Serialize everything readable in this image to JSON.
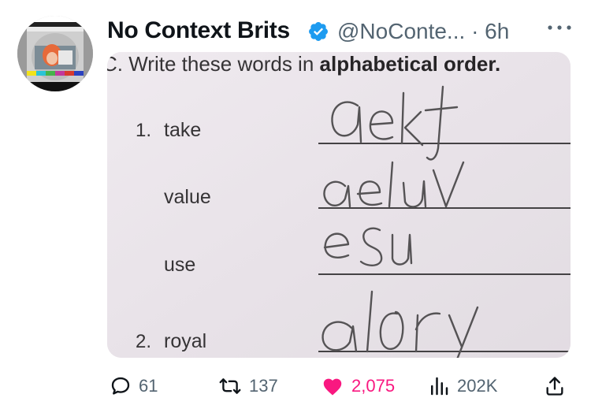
{
  "post": {
    "author": {
      "display_name": "No Context Brits",
      "handle": "@NoConte...",
      "separator": "·",
      "time": "6h"
    },
    "media": {
      "header_prefix": "C. Write these words in ",
      "header_bold": "alphabetical order.",
      "rows": [
        {
          "number": "1.",
          "word": "take",
          "answer": "aekt"
        },
        {
          "number": "",
          "word": "value",
          "answer": "aeluv"
        },
        {
          "number": "",
          "word": "use",
          "answer": "esu"
        },
        {
          "number": "2.",
          "word": "royal",
          "answer": "alory"
        }
      ]
    },
    "metrics": {
      "replies": "61",
      "reposts": "137",
      "likes": "2,075",
      "views": "202K"
    }
  },
  "colors": {
    "text": "#0f1419",
    "secondary": "#536471",
    "verified": "#1d9bf0",
    "like": "#f91880"
  }
}
